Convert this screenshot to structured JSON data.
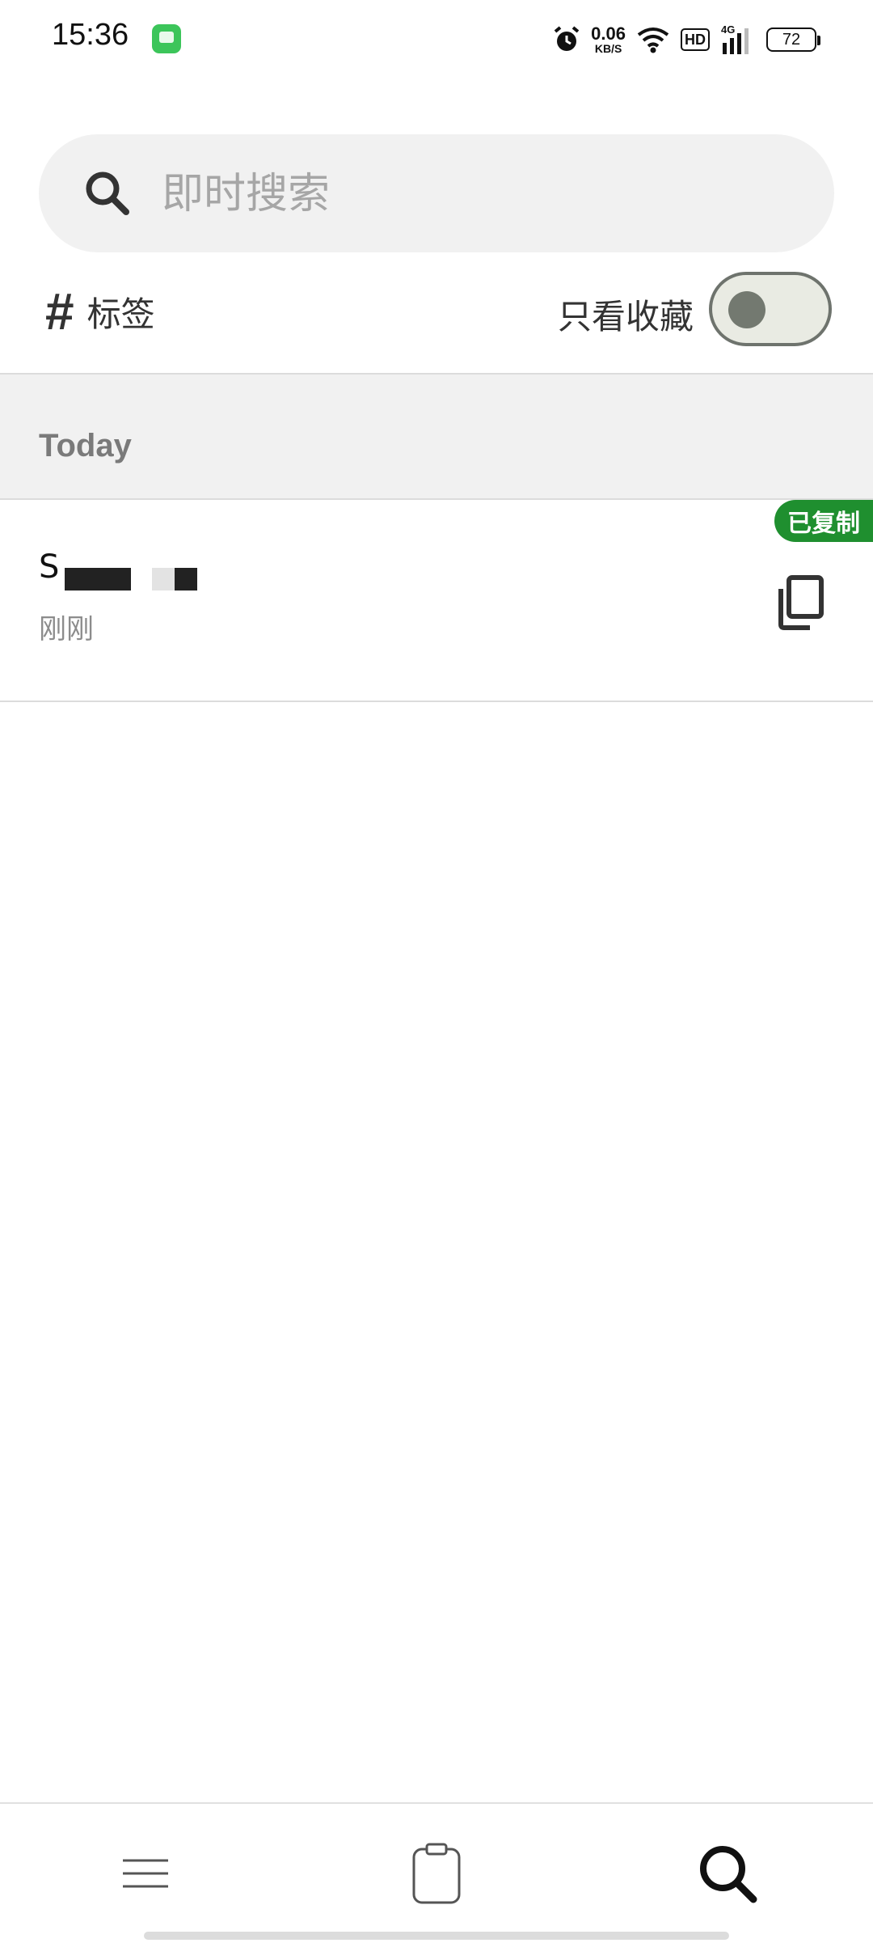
{
  "status_bar": {
    "time": "15:36",
    "net_speed_value": "0.06",
    "net_speed_unit": "KB/S",
    "hd": "HD",
    "signal_label": "4G",
    "battery": "72"
  },
  "search": {
    "placeholder": "即时搜索",
    "icon": "search-icon"
  },
  "filters": {
    "tags_label": "标签",
    "favorites_label": "只看收藏",
    "favorites_only": false
  },
  "sections": [
    {
      "title": "Today",
      "items": [
        {
          "text": "S",
          "time": "刚刚",
          "badge": "已复制"
        }
      ]
    }
  ],
  "nav": {
    "items": [
      {
        "icon": "menu-icon",
        "active": false
      },
      {
        "icon": "clipboard-icon",
        "active": false
      },
      {
        "icon": "search-icon",
        "active": true
      }
    ]
  },
  "colors": {
    "badge_green": "#1f8f2f",
    "search_bg": "#f1f1f1",
    "section_bg": "#f1f1f1"
  }
}
